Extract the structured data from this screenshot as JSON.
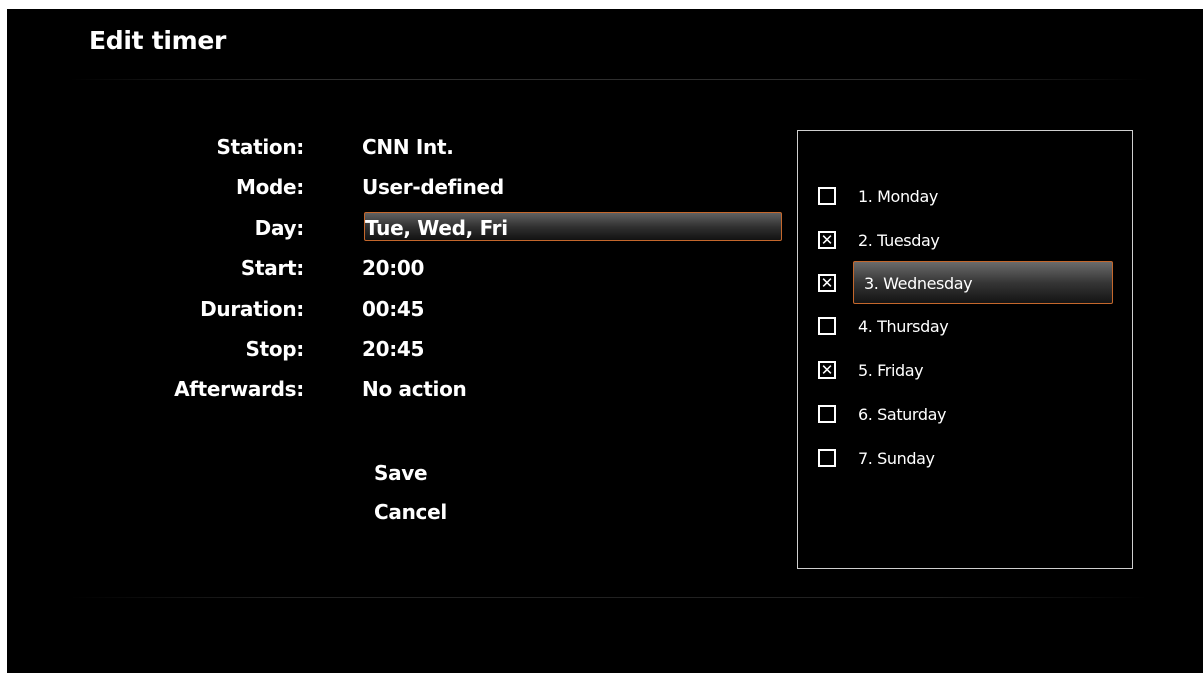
{
  "screen": {
    "title": "Edit timer"
  },
  "form": {
    "fields": [
      {
        "label": "Station:",
        "value": "CNN Int."
      },
      {
        "label": "Mode:",
        "value": "User-defined"
      },
      {
        "label": "Day:",
        "value": "Tue, Wed, Fri",
        "selected": true
      },
      {
        "label": "Start:",
        "value": "20:00"
      },
      {
        "label": "Duration:",
        "value": "00:45"
      },
      {
        "label": "Stop:",
        "value": "20:45"
      },
      {
        "label": "Afterwards:",
        "value": "No action"
      }
    ],
    "actions": {
      "save": "Save",
      "cancel": "Cancel"
    }
  },
  "day_picker": {
    "days": [
      {
        "label": "1. Monday",
        "checked": false,
        "check_glyph": ""
      },
      {
        "label": "2. Tuesday",
        "checked": true,
        "check_glyph": "✕"
      },
      {
        "label": "3. Wednesday",
        "checked": true,
        "check_glyph": "✕",
        "focused": true
      },
      {
        "label": "4. Thursday",
        "checked": false,
        "check_glyph": ""
      },
      {
        "label": "5. Friday",
        "checked": true,
        "check_glyph": "✕"
      },
      {
        "label": "6. Saturday",
        "checked": false,
        "check_glyph": ""
      },
      {
        "label": "7. Sunday",
        "checked": false,
        "check_glyph": ""
      }
    ]
  },
  "colors": {
    "background": "#000000",
    "text": "#ffffff",
    "focus_border": "#c4672c"
  }
}
